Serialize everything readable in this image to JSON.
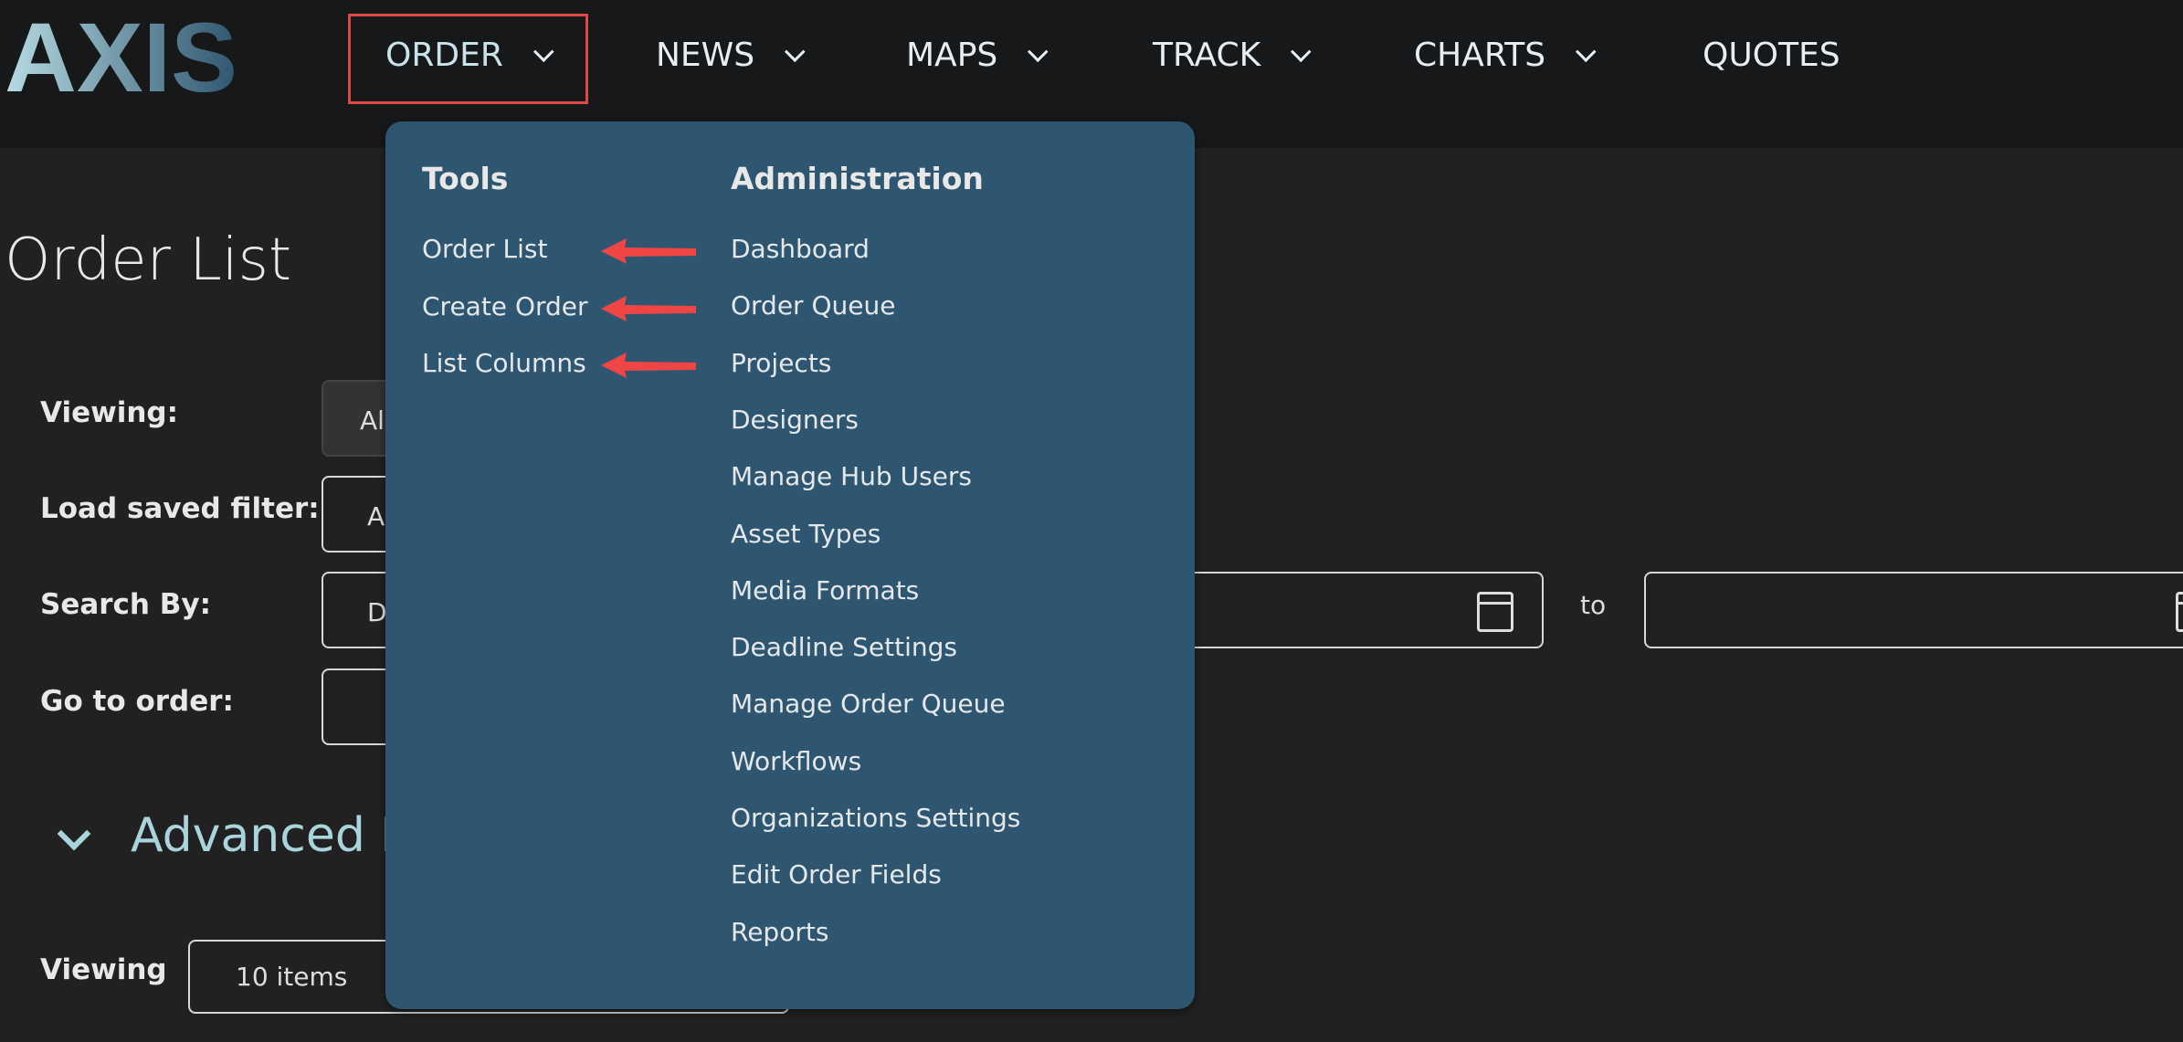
{
  "logo": {
    "text": "AXIS"
  },
  "nav": [
    {
      "label": "ORDER"
    },
    {
      "label": "NEWS"
    },
    {
      "label": "MAPS"
    },
    {
      "label": "TRACK"
    },
    {
      "label": "CHARTS"
    },
    {
      "label": "QUOTES"
    }
  ],
  "dropdown": {
    "tools": {
      "heading": "Tools",
      "items": [
        "Order List",
        "Create Order",
        "List Columns"
      ]
    },
    "admin": {
      "heading": "Administration",
      "items": [
        "Dashboard",
        "Order Queue",
        "Projects",
        "Designers",
        "Manage Hub Users",
        "Asset Types",
        "Media Formats",
        "Deadline Settings",
        "Manage Order Queue",
        "Workflows",
        "Organizations Settings",
        "Edit Order Fields",
        "Reports"
      ]
    }
  },
  "page": {
    "title": "Order List"
  },
  "filters": {
    "viewing_label": "Viewing:",
    "viewing_value": "Al",
    "saved_label": "Load saved filter:",
    "saved_value": "A",
    "search_label": "Search By:",
    "search_value": "D",
    "to_label": "to",
    "goto_label": "Go to order:"
  },
  "advanced": {
    "label": "Advanced F"
  },
  "pager": {
    "label": "Viewing",
    "value": "10 items"
  },
  "colors": {
    "menu_bg": "#2f5670",
    "highlight": "#e04848",
    "arrow": "#f04545"
  }
}
